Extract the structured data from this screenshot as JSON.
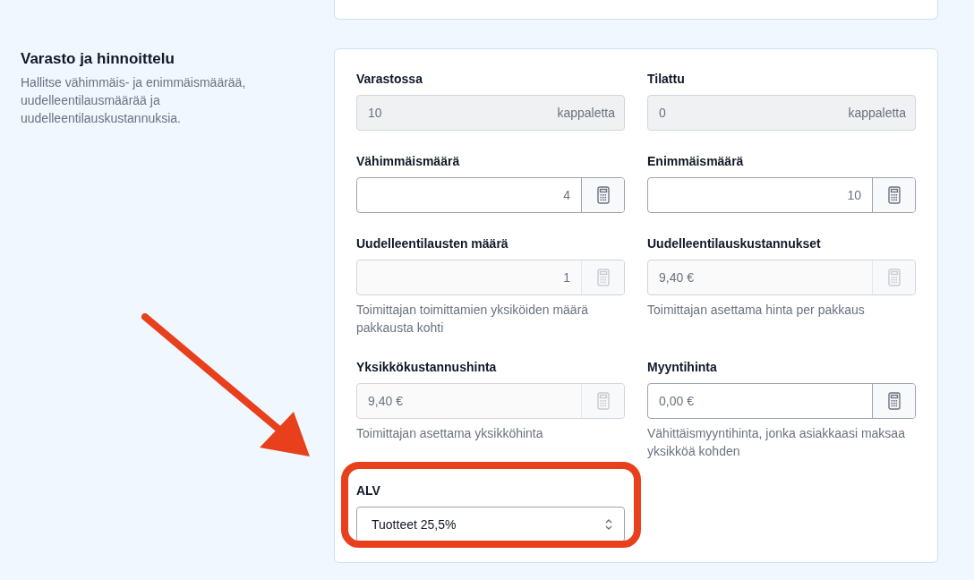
{
  "section": {
    "title": "Varasto ja hinnoittelu",
    "description": "Hallitse vähimmäis- ja enimmäismäärää, uudelleentilausmäärää ja uudelleentilauskustannuksia."
  },
  "fields": [
    {
      "kind": "unit",
      "label": "Varastossa",
      "value": "10",
      "suffix": "kappaletta",
      "disabled": true
    },
    {
      "kind": "unit",
      "label": "Tilattu",
      "value": "0",
      "suffix": "kappaletta",
      "disabled": true
    },
    {
      "kind": "count",
      "label": "Vähimmäismäärä",
      "value": "4",
      "disabled": false
    },
    {
      "kind": "count",
      "label": "Enimmäismäärä",
      "value": "10",
      "disabled": false
    },
    {
      "kind": "count",
      "label": "Uudelleentilausten määrä",
      "value": "1",
      "disabled": true,
      "help": "Toimittajan toimittamien yksiköiden määrä pakkausta kohti"
    },
    {
      "kind": "price",
      "label": "Uudelleentilauskustannukset",
      "value": "9,40 €",
      "disabled": true,
      "help": "Toimittajan asettama hinta per pakkaus"
    },
    {
      "kind": "price",
      "label": "Yksikkökustannushinta",
      "value": "9,40 €",
      "disabled": true,
      "help": "Toimittajan asettama yksikköhinta"
    },
    {
      "kind": "price",
      "label": "Myyntihinta",
      "placeholder": "0,00 €",
      "disabled": false,
      "help": "Vähittäismyyntihinta, jonka asiakkaasi maksaa yksikköä kohden"
    },
    {
      "kind": "select",
      "label": "ALV",
      "value": "Tuotteet 25,5%",
      "disabled": false,
      "highlighted": true
    }
  ],
  "annotations": [
    {
      "kind": "arrow",
      "color": "#e8401c"
    }
  ]
}
